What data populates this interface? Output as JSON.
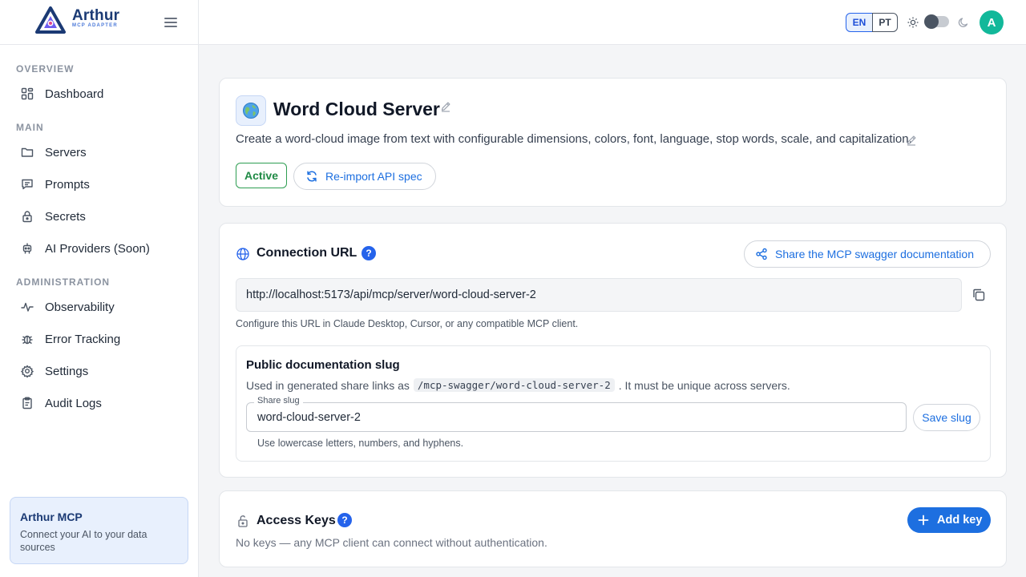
{
  "brand": {
    "name": "Arthur",
    "subtitle": "MCP ADAPTER",
    "colors": {
      "primary": "#1b3a74",
      "accent": "#4a78d8"
    }
  },
  "sidebar": {
    "sections": [
      {
        "label": "OVERVIEW",
        "items": [
          {
            "label": "Dashboard",
            "icon": "dashboard-icon"
          }
        ]
      },
      {
        "label": "MAIN",
        "items": [
          {
            "label": "Servers",
            "icon": "folder-icon"
          },
          {
            "label": "Prompts",
            "icon": "chat-icon"
          },
          {
            "label": "Secrets",
            "icon": "lock-icon"
          },
          {
            "label": "AI Providers (Soon)",
            "icon": "robot-icon"
          }
        ]
      },
      {
        "label": "ADMINISTRATION",
        "items": [
          {
            "label": "Observability",
            "icon": "activity-icon"
          },
          {
            "label": "Error Tracking",
            "icon": "bug-icon"
          },
          {
            "label": "Settings",
            "icon": "gear-icon"
          },
          {
            "label": "Audit Logs",
            "icon": "clipboard-icon"
          }
        ]
      }
    ],
    "promo": {
      "title": "Arthur MCP",
      "text": "Connect your AI to your data sources"
    }
  },
  "topbar": {
    "languages": [
      "EN",
      "PT"
    ],
    "active_language": "EN",
    "theme_toggle": "light",
    "avatar_initial": "A",
    "avatar_color": "#12b89a"
  },
  "server": {
    "title": "Word Cloud Server",
    "description": "Create a word-cloud image from text with configurable dimensions, colors, font, language, stop words, scale, and capitalization.",
    "status": "Active",
    "status_color": "#1f8a45",
    "reimport_label": "Re-import API spec"
  },
  "connection": {
    "title": "Connection URL",
    "help": "?",
    "share_label": "Share the MCP swagger documentation",
    "url": "http://localhost:5173/api/mcp/server/word-cloud-server-2",
    "hint": "Configure this URL in Claude Desktop, Cursor, or any compatible MCP client.",
    "slug": {
      "title": "Public documentation slug",
      "desc_before": "Used in generated share links as",
      "desc_code": "/mcp-swagger/word-cloud-server-2",
      "desc_after": ". It must be unique across servers.",
      "field_label": "Share slug",
      "value": "word-cloud-server-2",
      "save_label": "Save slug",
      "hint": "Use lowercase letters, numbers, and hyphens."
    }
  },
  "access_keys": {
    "title": "Access Keys",
    "help": "?",
    "add_label": "Add key",
    "empty_text": "No keys — any MCP client can connect without authentication."
  }
}
